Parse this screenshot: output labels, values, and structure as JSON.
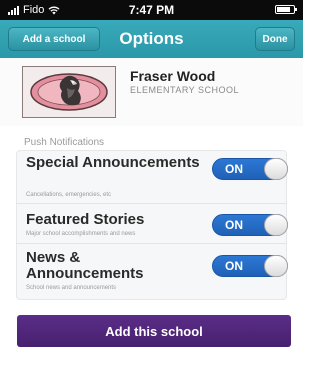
{
  "status_bar": {
    "carrier": "Fido",
    "time": "7:47 PM"
  },
  "nav": {
    "back_label": "Add a school",
    "title": "Options",
    "done_label": "Done"
  },
  "school": {
    "name": "Fraser Wood",
    "type": "ELEMENTARY SCHOOL"
  },
  "section_title": "Push Notifications",
  "settings": [
    {
      "title": "Special Announcements",
      "description": "Cancellations, emergencies, etc",
      "toggle_label": "ON",
      "enabled": true
    },
    {
      "title": "Featured Stories",
      "description": "Major school accomplishments and news",
      "toggle_label": "ON",
      "enabled": true
    },
    {
      "title": "News & Announcements",
      "description": "School news and announcements",
      "toggle_label": "ON",
      "enabled": true
    }
  ],
  "add_button_label": "Add this school",
  "colors": {
    "nav": "#2fa2b2",
    "toggle_on": "#2a72cf",
    "add_button": "#502679"
  }
}
